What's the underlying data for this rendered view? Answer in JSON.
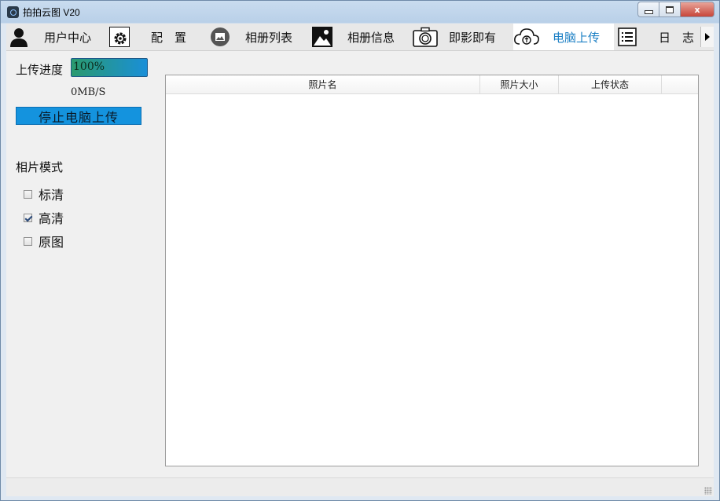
{
  "window": {
    "title": "拍拍云图 V20",
    "close_glyph": "x"
  },
  "tabs": [
    {
      "label": "用户中心",
      "icon": "user-icon"
    },
    {
      "label": "配　置",
      "icon": "gear-icon"
    },
    {
      "label": "相册列表",
      "icon": "album-icon"
    },
    {
      "label": "相册信息",
      "icon": "image-icon"
    },
    {
      "label": "即影即有",
      "icon": "camera-icon"
    },
    {
      "label": "电脑上传",
      "icon": "cloud-upload-icon",
      "active": true
    },
    {
      "label": "日　志",
      "icon": "list-icon"
    }
  ],
  "upload": {
    "progress_label": "上传进度",
    "progress_value": "100%",
    "progress_fraction": 1.0,
    "speed": "0MB/S",
    "stop_button": "停止电脑上传"
  },
  "photo_mode": {
    "title": "相片模式",
    "options": [
      {
        "label": "标清",
        "checked": false
      },
      {
        "label": "高清",
        "checked": true
      },
      {
        "label": "原图",
        "checked": false
      }
    ]
  },
  "table": {
    "columns": [
      "照片名",
      "照片大小",
      "上传状态"
    ],
    "rows": []
  },
  "colors": {
    "active_tab_text": "#1b7fc4",
    "stop_button_bg": "#1493de",
    "progress_start": "#2a9a6e",
    "progress_end": "#1a8fd8"
  }
}
